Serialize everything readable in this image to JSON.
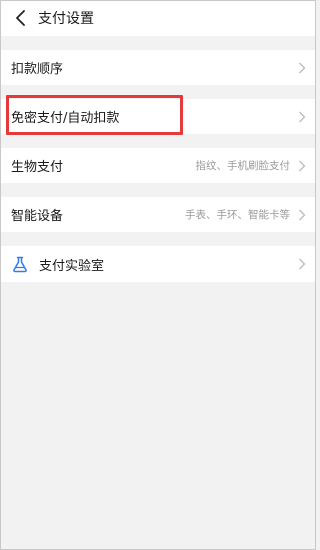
{
  "header": {
    "title": "支付设置"
  },
  "groups": [
    {
      "items": [
        {
          "label": "扣款顺序",
          "value": ""
        }
      ]
    },
    {
      "items": [
        {
          "label": "免密支付/自动扣款",
          "value": ""
        }
      ]
    },
    {
      "items": [
        {
          "label": "生物支付",
          "value": "指纹、手机刷脸支付"
        }
      ]
    },
    {
      "items": [
        {
          "label": "智能设备",
          "value": "手表、手环、智能卡等"
        }
      ]
    },
    {
      "items": [
        {
          "label": "支付实验室",
          "value": ""
        }
      ]
    }
  ],
  "icons": {
    "back": "chevron-left-icon",
    "row_arrow": "chevron-right-icon",
    "lab": "flask-icon"
  },
  "colors": {
    "highlight": "#e5393a",
    "lab_icon": "#2f7cf6"
  }
}
